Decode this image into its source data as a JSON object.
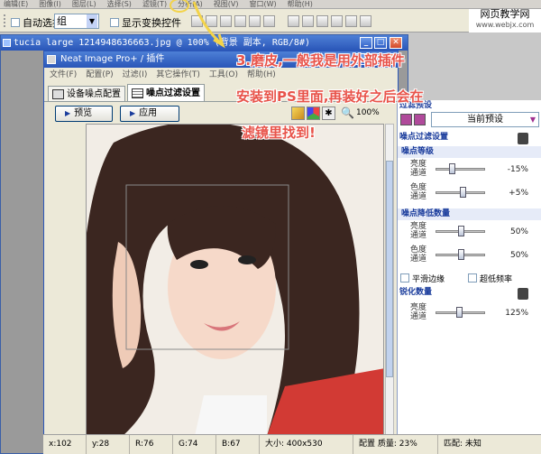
{
  "ps_menu": [
    "编辑(E)",
    "图像(I)",
    "图层(L)",
    "选择(S)",
    "滤镜(T)",
    "分析(A)",
    "视图(V)",
    "窗口(W)",
    "帮助(H)"
  ],
  "ps_options": {
    "auto_select": "自动选择:",
    "group_value": "组",
    "show_transform": "显示变换控件"
  },
  "watermark": {
    "line1": "网页教学网",
    "line2": "www.webjx.com"
  },
  "doc_title": "tucia large 1214948636663.jpg @ 100% (背景 副本, RGB/8#)",
  "ni": {
    "title": "Neat Image Pro+ / 插件",
    "menu": [
      "文件(F)",
      "配置(P)",
      "过滤(I)",
      "其它操作(T)",
      "工具(O)",
      "帮助(H)"
    ],
    "tabs": [
      "设备噪点配置",
      "噪点过滤设置"
    ],
    "preview_btn": "预览",
    "apply_btn": "应用",
    "zoom": "100%"
  },
  "panel": {
    "presets_header": "过滤预设",
    "preset_value": "当前预设",
    "noise_header": "噪点过滤设置",
    "level_header": "噪点等级",
    "level_rows": [
      {
        "label": "亮度通道",
        "value": "-15%",
        "pos": 0.3
      },
      {
        "label": "色度通道",
        "value": "+5%",
        "pos": 0.55
      }
    ],
    "reduction_header": "噪点降低数量",
    "reduction_rows": [
      {
        "label": "亮度通道",
        "value": "50%",
        "pos": 0.5
      },
      {
        "label": "色度通道",
        "value": "50%",
        "pos": 0.5
      }
    ],
    "smooth_edges": "平滑边缘",
    "ultra_low_freq": "超低频率",
    "sharpen_header": "锐化数量",
    "sharpen_rows": [
      {
        "label": "亮度通道",
        "value": "125%",
        "pos": 0.45
      }
    ]
  },
  "status": {
    "x": "x:102",
    "y": "y:28",
    "r": "R:76",
    "g": "G:74",
    "b": "B:67",
    "size": "大小: 400x530",
    "config": "配置 质量: 23%",
    "match": "匹配: 未知"
  },
  "notes": {
    "step": "3.磨皮,一般我是用外部插件",
    "install": "安装到PS里面,再装好之后会在",
    "find": "滤镜里找到!"
  },
  "colors": {
    "title_blue": "#2a56b8",
    "note_red": "#e8534a"
  }
}
